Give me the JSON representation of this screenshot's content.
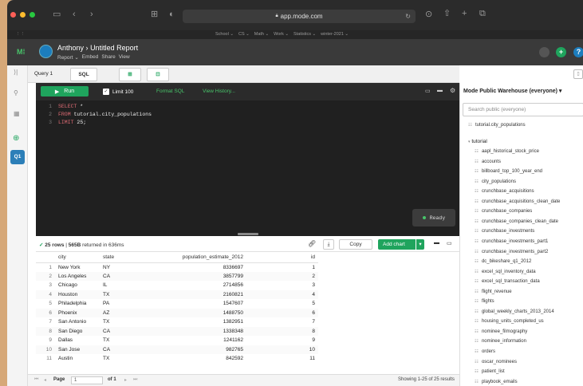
{
  "browser": {
    "url": "app.mode.com"
  },
  "bookmarks": [
    "School ⌄",
    "CS ⌄",
    "Math ⌄",
    "Work ⌄",
    "Statistics ⌄",
    "winter-2021 ⌄"
  ],
  "header": {
    "user": "Anthony",
    "separator": "›",
    "title": "Untitled Report",
    "sub": [
      "Report ⌄",
      "Embed",
      "Share",
      "View"
    ]
  },
  "rail": {
    "q1": "Q1"
  },
  "tabs": {
    "query": "Query 1",
    "sql": "SQL"
  },
  "editor": {
    "run": "Run",
    "limit": "Limit 100",
    "format": "Format SQL",
    "history": "View History...",
    "lines": [
      {
        "num": "1",
        "kw": "SELECT",
        "rest": " *"
      },
      {
        "num": "2",
        "kw": "FROM",
        "rest": " tutorial.city_populations"
      },
      {
        "num": "3",
        "kw": "LIMIT",
        "rest": " 25;"
      }
    ],
    "status": "Ready"
  },
  "results": {
    "rows": "25 rows",
    "size": "565B",
    "rest": " returned in 636ms",
    "copy": "Copy",
    "add_chart": "Add chart",
    "columns": [
      "city",
      "state",
      "population_estimate_2012",
      "id"
    ],
    "data": [
      [
        "1",
        "New York",
        "NY",
        "8336697",
        "1"
      ],
      [
        "2",
        "Los Angeles",
        "CA",
        "3857799",
        "2"
      ],
      [
        "3",
        "Chicago",
        "IL",
        "2714856",
        "3"
      ],
      [
        "4",
        "Houston",
        "TX",
        "2160821",
        "4"
      ],
      [
        "5",
        "Philadelphia",
        "PA",
        "1547607",
        "5"
      ],
      [
        "6",
        "Phoenix",
        "AZ",
        "1488750",
        "6"
      ],
      [
        "7",
        "San Antonio",
        "TX",
        "1382951",
        "7"
      ],
      [
        "8",
        "San Diego",
        "CA",
        "1338348",
        "8"
      ],
      [
        "9",
        "Dallas",
        "TX",
        "1241162",
        "9"
      ],
      [
        "10",
        "San Jose",
        "CA",
        "982765",
        "10"
      ],
      [
        "11",
        "Austin",
        "TX",
        "842592",
        "11"
      ]
    ]
  },
  "pager": {
    "page_label": "Page",
    "page": "1",
    "of": "of 1",
    "showing": "Showing 1-25 of 25 results"
  },
  "schema": {
    "title": "Mode Public Warehouse (everyone) ▾",
    "search_placeholder": "Search public (everyone)",
    "pinned": "tutorial.city_populations",
    "group": "tutorial",
    "tables": [
      "aapl_historical_stock_price",
      "accounts",
      "billboard_top_100_year_end",
      "city_populations",
      "crunchbase_acquisitions",
      "crunchbase_acquisitions_clean_date",
      "crunchbase_companies",
      "crunchbase_companies_clean_date",
      "crunchbase_investments",
      "crunchbase_investments_part1",
      "crunchbase_investments_part2",
      "dc_bikeshare_q1_2012",
      "excel_sql_inventory_data",
      "excel_sql_transaction_data",
      "flight_revenue",
      "flights",
      "global_weekly_charts_2013_2014",
      "housing_units_completed_us",
      "nominee_filmography",
      "nominee_information",
      "orders",
      "oscar_nominees",
      "patient_list",
      "playbook_emails"
    ]
  }
}
